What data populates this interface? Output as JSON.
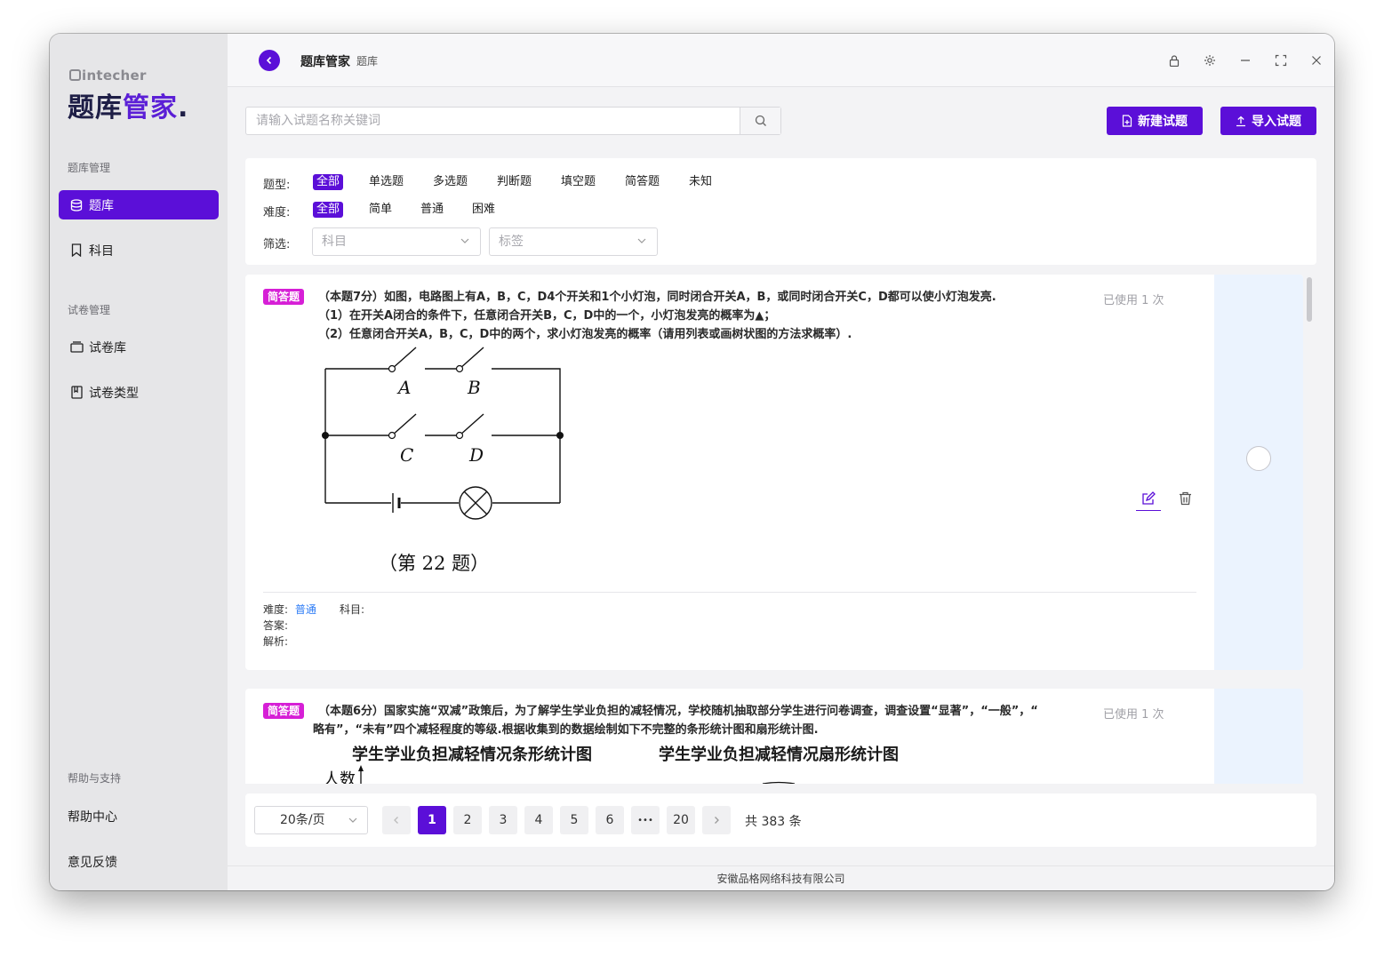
{
  "brand": {
    "small": "intecher",
    "big_main": "题库",
    "big_accent": "管家",
    "big_dot": "."
  },
  "sidebar": {
    "section_bank": "题库管理",
    "item_bank": "题库",
    "item_subject": "科目",
    "section_paper": "试卷管理",
    "item_paper_lib": "试卷库",
    "item_paper_type": "试卷类型",
    "section_help": "帮助与支持",
    "help_center": "帮助中心",
    "feedback": "意见反馈"
  },
  "header": {
    "title": "题库管家",
    "subtitle": "题库"
  },
  "search": {
    "placeholder": "请输入试题名称关键词",
    "value": ""
  },
  "actions": {
    "new_question": "新建试题",
    "import_question": "导入试题"
  },
  "filters": {
    "type_label": "题型:",
    "type_options": [
      "全部",
      "单选题",
      "多选题",
      "判断题",
      "填空题",
      "简答题",
      "未知"
    ],
    "difficulty_label": "难度:",
    "difficulty_options": [
      "全部",
      "简单",
      "普通",
      "困难"
    ],
    "screen_label": "筛选:",
    "subject_placeholder": "科目",
    "tag_placeholder": "标签"
  },
  "questions": [
    {
      "badge": "简答题",
      "lines": [
        "（本题7分）如图，电路图上有A，B，C，D4个开关和1个小灯泡，同时闭合开关A，B，或同时闭合开关C，D都可以使小灯泡发亮.",
        "（1）在开关A闭合的条件下，任意闭合开关B，C，D中的一个，小灯泡发亮的概率为▲；",
        "（2）任意闭合开关A，B，C，D中的两个，求小灯泡发亮的概率（请用列表或画树状图的方法求概率）."
      ],
      "used": "已使用 1 次",
      "figure_labels": {
        "a": "A",
        "b": "B",
        "c": "C",
        "d": "D",
        "caption": "（第 22 题）"
      },
      "difficulty_label": "难度:",
      "difficulty_value": "普通",
      "subject_label": "科目:",
      "answer_label": "答案:",
      "analysis_label": "解析:"
    },
    {
      "badge": "简答题",
      "lines": [
        "（本题6分）国家实施“双减”政策后，为了解学生学业负担的减轻情况，学校随机抽取部分学生进行问卷调查，调查设置“显著”，“一般”，“",
        "略有”，“未有”四个减轻程度的等级.根据收集到的数据绘制如下不完整的条形统计图和扇形统计图."
      ],
      "used": "已使用 1 次",
      "chart_title_bar": "学生学业负担减轻情况条形统计图",
      "chart_title_pie": "学生学业负担减轻情况扇形统计图",
      "y_label": "人数"
    }
  ],
  "pagination": {
    "page_size": "20条/页",
    "pages": [
      "1",
      "2",
      "3",
      "4",
      "5",
      "6",
      "•••",
      "20"
    ],
    "current": "1",
    "total": "共 383 条"
  },
  "footer": "安徽品格网络科技有限公司",
  "colors": {
    "accent": "#5b0fd8",
    "badge": "#d61fd6",
    "link": "#2d7cf6",
    "side_panel": "#ebf3fe"
  }
}
